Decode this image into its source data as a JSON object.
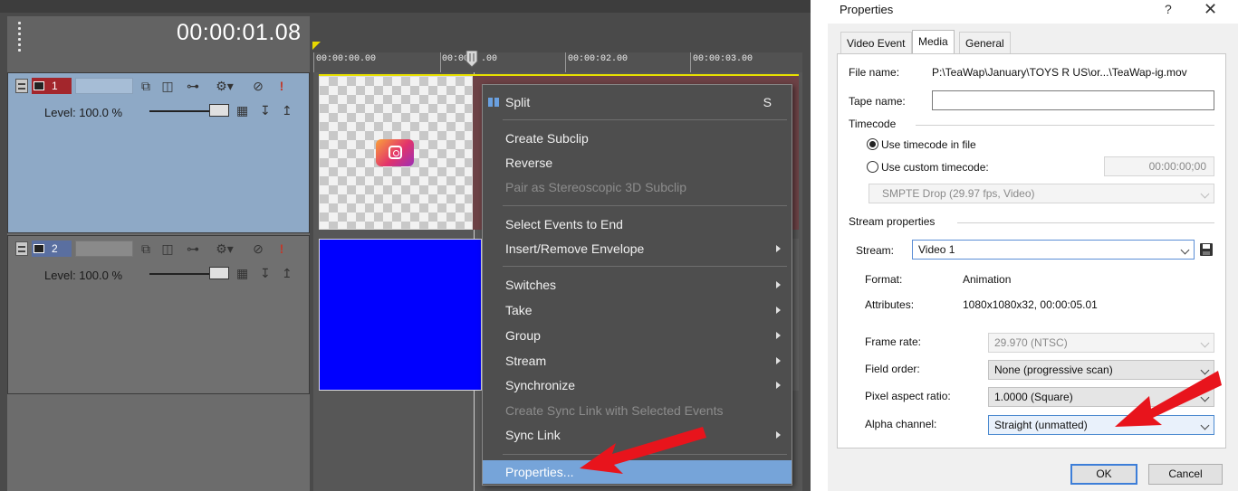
{
  "vegas": {
    "timecode": "00:00:01.08",
    "tracks": [
      {
        "number": "1",
        "level_label": "Level: 100.0 %"
      },
      {
        "number": "2",
        "level_label": "Level: 100.0 %"
      }
    ],
    "ruler": [
      "00:00:00.00",
      "00:00",
      ".00",
      "00:00:02.00",
      "00:00:03.00"
    ],
    "colors": {
      "track1_header": "#8ea9c6",
      "track2_header": "#707070",
      "event_blue": "#0000ff",
      "menu_bg": "#4e4e4e",
      "menu_highlight": "#76a4d9",
      "arrow_red": "#e8141c"
    },
    "event_icon": "instagram-icon"
  },
  "context_menu": {
    "items": [
      {
        "label": "Split",
        "shortcut": "S",
        "submenu": false,
        "disabled": false
      },
      {
        "label": "Create Subclip",
        "submenu": false,
        "disabled": false
      },
      {
        "label": "Reverse",
        "submenu": false,
        "disabled": false
      },
      {
        "label": "Pair as Stereoscopic 3D Subclip",
        "submenu": false,
        "disabled": true
      },
      {
        "label": "Select Events to End",
        "submenu": false,
        "disabled": false
      },
      {
        "label": "Insert/Remove Envelope",
        "submenu": true,
        "disabled": false
      },
      {
        "label": "Switches",
        "submenu": true,
        "disabled": false
      },
      {
        "label": "Take",
        "submenu": true,
        "disabled": false
      },
      {
        "label": "Group",
        "submenu": true,
        "disabled": false
      },
      {
        "label": "Stream",
        "submenu": true,
        "disabled": false
      },
      {
        "label": "Synchronize",
        "submenu": true,
        "disabled": false
      },
      {
        "label": "Create Sync Link with Selected Events",
        "submenu": false,
        "disabled": true
      },
      {
        "label": "Sync Link",
        "submenu": true,
        "disabled": false
      },
      {
        "label": "Properties...",
        "submenu": false,
        "disabled": false,
        "highlighted": true
      }
    ]
  },
  "dialog": {
    "title": "Properties",
    "help": "?",
    "close": "✕",
    "tabs": [
      "Video Event",
      "Media",
      "General"
    ],
    "active_tab": "Media",
    "file_name_label": "File name:",
    "file_name_value": "P:\\TeaWap\\January\\TOYS R US\\or...\\TeaWap-ig.mov",
    "tape_name_label": "Tape name:",
    "tape_name_value": "",
    "timecode_group": "Timecode",
    "use_file_tc": "Use timecode in file",
    "use_custom_tc": "Use custom timecode:",
    "custom_tc_value": "00:00:00;00",
    "tc_format": "SMPTE Drop (29.97 fps, Video)",
    "stream_group": "Stream properties",
    "stream_label": "Stream:",
    "stream_value": "Video 1",
    "format_label": "Format:",
    "format_value": "Animation",
    "attributes_label": "Attributes:",
    "attributes_value": "1080x1080x32, 00:00:05.01",
    "frame_rate_label": "Frame rate:",
    "frame_rate_value": "29.970 (NTSC)",
    "field_order_label": "Field order:",
    "field_order_value": "None (progressive scan)",
    "par_label": "Pixel aspect ratio:",
    "par_value": "1.0000 (Square)",
    "alpha_label": "Alpha channel:",
    "alpha_value": "Straight (unmatted)",
    "ok": "OK",
    "cancel": "Cancel"
  }
}
